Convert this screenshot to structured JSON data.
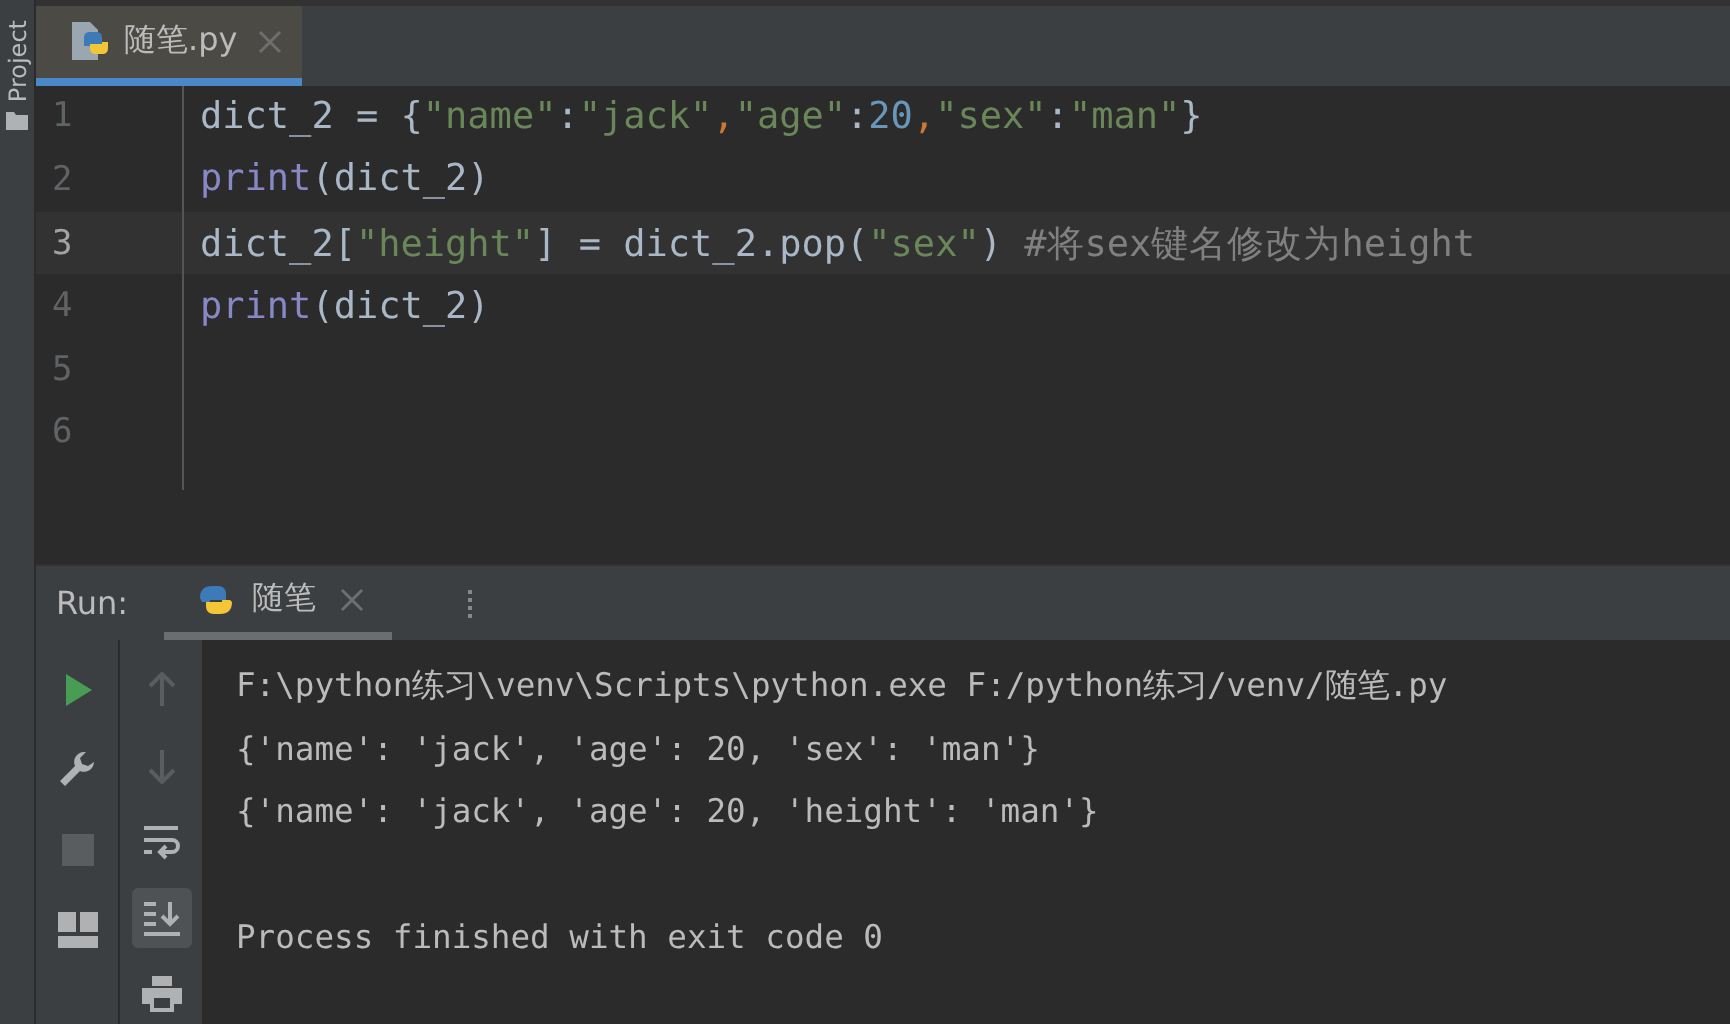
{
  "side_strip": {
    "label": "Project"
  },
  "editor_tabs": [
    {
      "label": "随笔.py",
      "selected": true
    }
  ],
  "code_lines": [
    {
      "number": "1",
      "current": false,
      "tokens": [
        {
          "kind": "plain",
          "text": "dict_2 = {"
        },
        {
          "kind": "string",
          "text": "\"name\""
        },
        {
          "kind": "plain",
          "text": ":"
        },
        {
          "kind": "string",
          "text": "\"jack\""
        },
        {
          "kind": "comma",
          "text": ","
        },
        {
          "kind": "string",
          "text": "\"age\""
        },
        {
          "kind": "plain",
          "text": ":"
        },
        {
          "kind": "number",
          "text": "20"
        },
        {
          "kind": "comma",
          "text": ","
        },
        {
          "kind": "string",
          "text": "\"sex\""
        },
        {
          "kind": "plain",
          "text": ":"
        },
        {
          "kind": "string",
          "text": "\"man\""
        },
        {
          "kind": "plain",
          "text": "}"
        }
      ]
    },
    {
      "number": "2",
      "current": false,
      "tokens": [
        {
          "kind": "builtin",
          "text": "print"
        },
        {
          "kind": "plain",
          "text": "(dict_2)"
        }
      ]
    },
    {
      "number": "3",
      "current": true,
      "tokens": [
        {
          "kind": "plain",
          "text": "dict_2["
        },
        {
          "kind": "string",
          "text": "\"height\""
        },
        {
          "kind": "plain",
          "text": "] = dict_2.pop("
        },
        {
          "kind": "string",
          "text": "\"sex\""
        },
        {
          "kind": "plain",
          "text": ") "
        },
        {
          "kind": "comment",
          "text": "#将sex键名修改为height"
        }
      ]
    },
    {
      "number": "4",
      "current": false,
      "tokens": [
        {
          "kind": "builtin",
          "text": "print"
        },
        {
          "kind": "plain",
          "text": "(dict_2)"
        }
      ]
    },
    {
      "number": "5",
      "current": false
    },
    {
      "number": "6",
      "current": false
    }
  ],
  "run_panel": {
    "label": "Run:",
    "tabs": [
      {
        "label": "随笔",
        "selected": true
      }
    ],
    "tools_left": [
      {
        "kind": "run",
        "disabled": false,
        "selected": false
      },
      {
        "kind": "wrench",
        "disabled": false,
        "selected": false
      },
      {
        "kind": "stop",
        "disabled": true,
        "selected": false
      },
      {
        "kind": "layout",
        "disabled": false,
        "selected": false
      }
    ],
    "tools_right": [
      {
        "kind": "up",
        "disabled": true,
        "selected": false
      },
      {
        "kind": "down",
        "disabled": true,
        "selected": false
      },
      {
        "kind": "wrap",
        "disabled": false,
        "selected": false
      },
      {
        "kind": "scroll_end",
        "disabled": false,
        "selected": true
      },
      {
        "kind": "print",
        "disabled": false,
        "selected": false
      }
    ],
    "console_lines": [
      {
        "kind": "command",
        "text": "F:\\python练习\\venv\\Scripts\\python.exe F:/python练习/venv/随笔.py"
      },
      {
        "kind": "output",
        "text": "{'name': 'jack', 'age': 20, 'sex': 'man'}"
      },
      {
        "kind": "output",
        "text": "{'name': 'jack', 'age': 20, 'height': 'man'}"
      },
      {
        "kind": "exit",
        "text": "Process finished with exit code 0"
      }
    ]
  }
}
